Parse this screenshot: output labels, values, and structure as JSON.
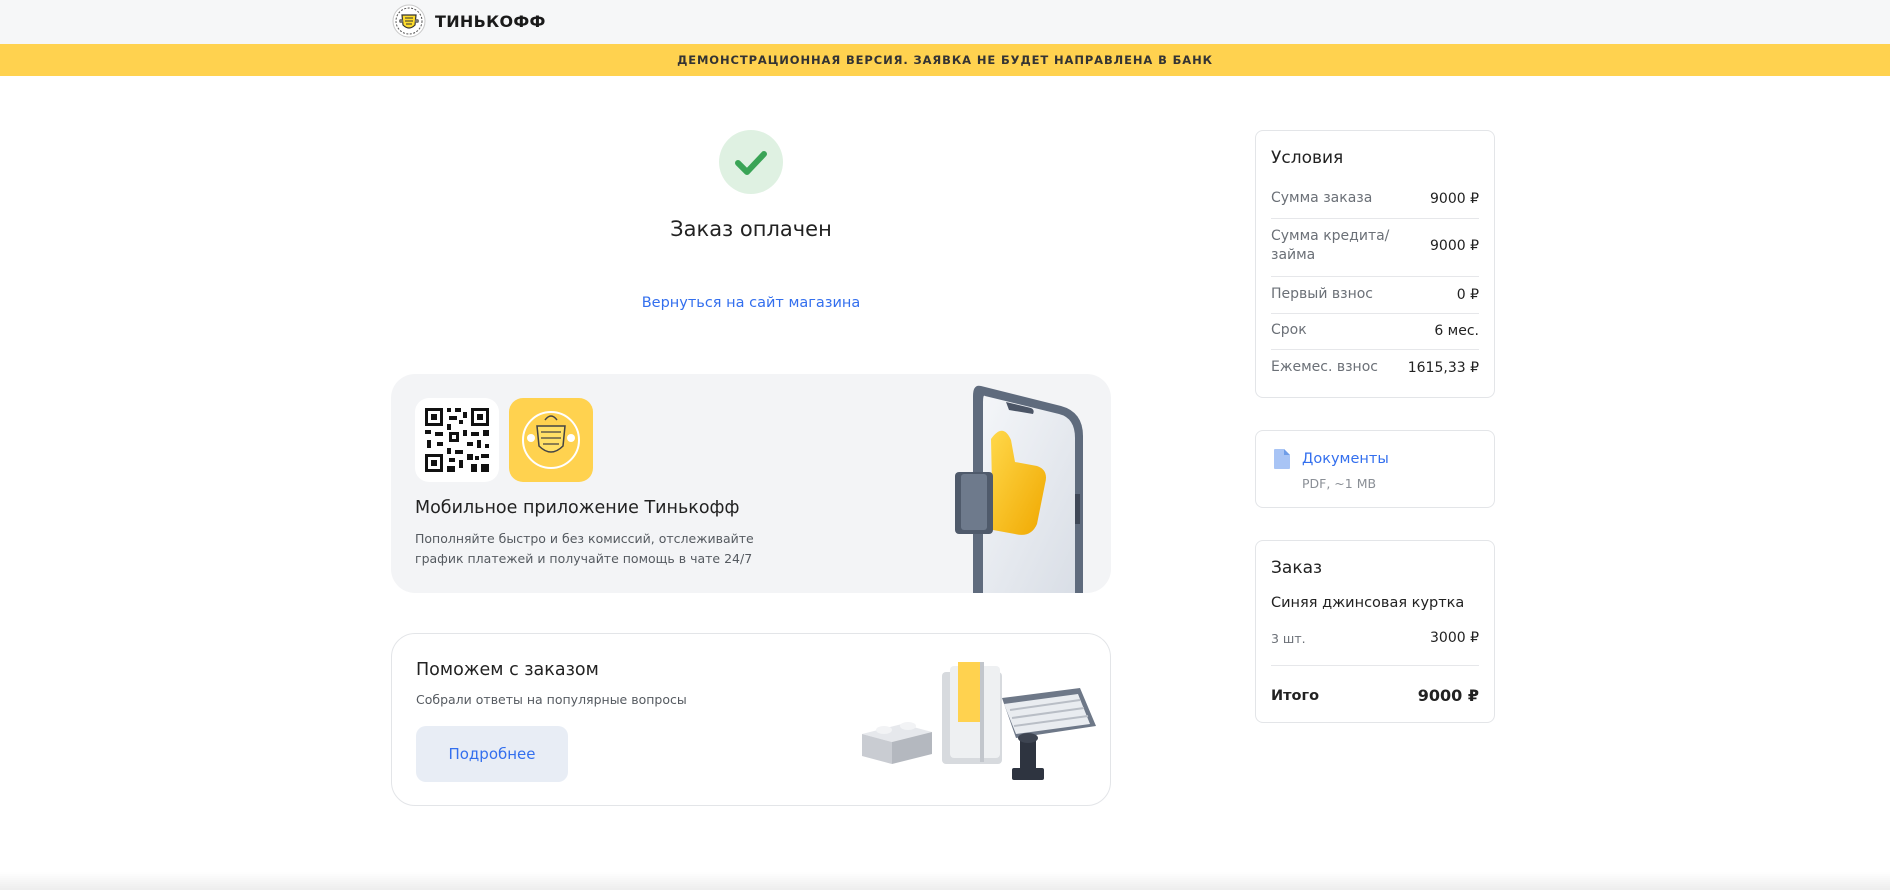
{
  "header": {
    "brand": "ТИНЬКОФФ",
    "demo_banner": "ДЕМОНСТРАЦИОННАЯ ВЕРСИЯ. ЗАЯВКА НЕ БУДЕТ НАПРАВЛЕНА В БАНК"
  },
  "status": {
    "title": "Заказ оплачен",
    "return_link": "Вернуться на сайт магазина"
  },
  "app_promo": {
    "title": "Мобильное приложение Тинькофф",
    "description": "Пополняйте быстро и без комиссий, отслеживайте график платежей и получайте помощь в чате 24/7"
  },
  "help": {
    "title": "Поможем с заказом",
    "description": "Собрали ответы на популярные вопросы",
    "button_label": "Подробнее"
  },
  "conditions": {
    "title": "Условия",
    "rows": [
      {
        "label": "Сумма заказа",
        "value": "9000 ₽"
      },
      {
        "label": "Сумма кредита/займа",
        "value": "9000 ₽"
      },
      {
        "label": "Первый взнос",
        "value": "0 ₽"
      },
      {
        "label": "Срок",
        "value": "6 мес."
      },
      {
        "label": "Ежемес. взнос",
        "value": "1615,33 ₽"
      }
    ]
  },
  "documents": {
    "link": "Документы",
    "meta": "PDF, ~1 MB"
  },
  "order": {
    "title": "Заказ",
    "item_name": "Синяя джинсовая куртка",
    "quantity": "3 шт.",
    "item_price": "3000 ₽",
    "total_label": "Итого",
    "total_value": "9000 ₽"
  },
  "colors": {
    "brand_yellow": "#ffd24f",
    "link_blue": "#336fee",
    "success_green": "#3aa456",
    "success_bg": "#dff1e2"
  },
  "icons": {
    "logo": "tinkoff-shield-emblem",
    "success": "checkmark-icon",
    "document": "document-icon",
    "qr": "qr-code",
    "app": "tinkoff-app-icon"
  }
}
